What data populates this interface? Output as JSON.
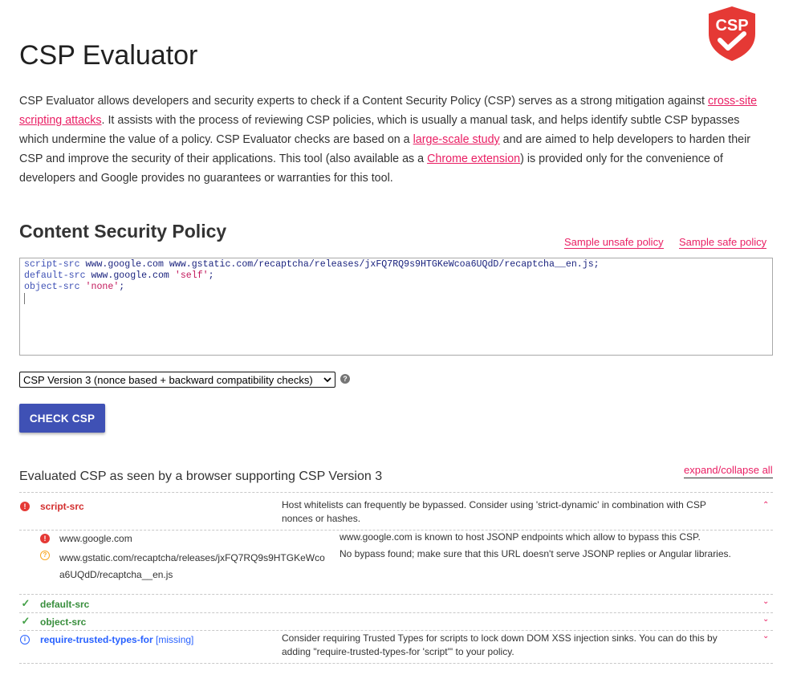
{
  "header": {
    "title": "CSP Evaluator",
    "logo_text": "CSP"
  },
  "intro": {
    "p1": "CSP Evaluator allows developers and security experts to check if a Content Security Policy (CSP) serves as a strong mitigation against ",
    "link1": "cross-site scripting attacks",
    "p2": ". It assists with the process of reviewing CSP policies, which is usually a manual task, and helps identify subtle CSP bypasses which undermine the value of a policy. CSP Evaluator checks are based on a ",
    "link2": "large-scale study",
    "p3": " and are aimed to help developers to harden their CSP and improve the security of their applications. This tool (also available as a ",
    "link3": "Chrome extension",
    "p4": ") is provided only for the convenience of developers and Google provides no guarantees or warranties for this tool."
  },
  "policy": {
    "section_title": "Content Security Policy",
    "sample_unsafe": "Sample unsafe policy",
    "sample_safe": "Sample safe policy",
    "line1_dir": "script-src",
    "line1_hosts": " www.google.com www.gstatic.com/recaptcha/releases/jxFQ7RQ9s9HTGKeWcoa6UQdD/recaptcha__en.js;",
    "line2_dir": "default-src",
    "line2_host": " www.google.com ",
    "line2_kw": "'self'",
    "line2_end": ";",
    "line3_dir": "object-src",
    "line3_kw": "'none'",
    "line3_end": ";"
  },
  "controls": {
    "version_selected": "CSP Version 3 (nonce based + backward compatibility checks)",
    "help_glyph": "?",
    "check_button": "CHECK CSP"
  },
  "results": {
    "title": "Evaluated CSP as seen by a browser supporting CSP Version 3",
    "expand_collapse": "expand/collapse all",
    "script_src": {
      "name": "script-src",
      "description": "Host whitelists can frequently be bypassed. Consider using 'strict-dynamic' in combination with CSP nonces or hashes.",
      "items": [
        {
          "value": "www.google.com",
          "finding": "www.google.com is known to host JSONP endpoints which allow to bypass this CSP."
        },
        {
          "value": "www.gstatic.com/recaptcha/releases/jxFQ7RQ9s9HTGKeWcoa6UQdD/recaptcha__en.js",
          "finding": "No bypass found; make sure that this URL doesn't serve JSONP replies or Angular libraries."
        }
      ]
    },
    "default_src": {
      "name": "default-src"
    },
    "object_src": {
      "name": "object-src"
    },
    "trusted_types": {
      "name": "require-trusted-types-for",
      "missing": "[missing]",
      "description": "Consider requiring Trusted Types for scripts to lock down DOM XSS injection sinks. You can do this by adding \"require-trusted-types-for 'script'\" to your policy."
    }
  },
  "colors": {
    "accent": "#e91e63",
    "button": "#3f51b5",
    "error": "#d32f2f",
    "ok": "#388e3c",
    "info": "#2962ff",
    "warning": "#f9a825"
  }
}
